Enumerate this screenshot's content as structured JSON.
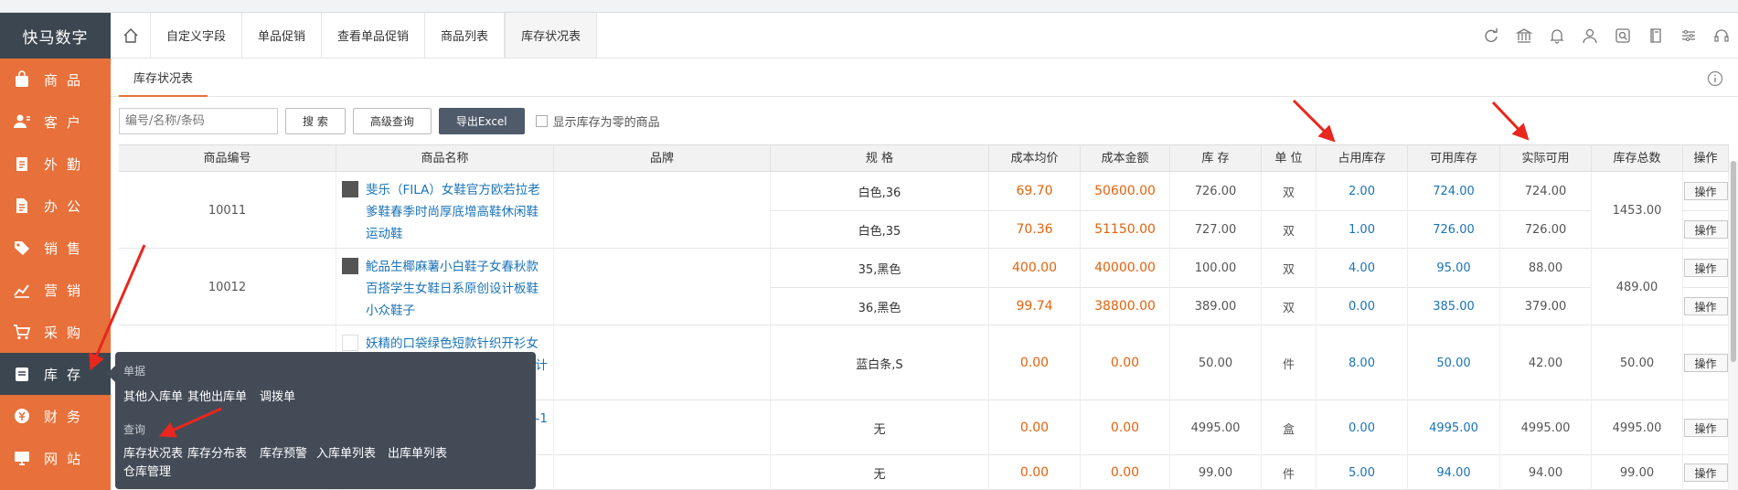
{
  "brand": "快马数字",
  "sidebar": {
    "items": [
      {
        "label": "商品",
        "icon": "bag-icon"
      },
      {
        "label": "客户",
        "icon": "user-icon"
      },
      {
        "label": "外勤",
        "icon": "clipboard-icon"
      },
      {
        "label": "办公",
        "icon": "document-icon"
      },
      {
        "label": "销售",
        "icon": "tag-icon"
      },
      {
        "label": "营销",
        "icon": "chart-icon"
      },
      {
        "label": "采购",
        "icon": "cart-icon"
      },
      {
        "label": "库存",
        "icon": "inventory-icon"
      },
      {
        "label": "财务",
        "icon": "money-icon"
      },
      {
        "label": "网站",
        "icon": "monitor-icon"
      }
    ]
  },
  "tabs": [
    "自定义字段",
    "单品促销",
    "查看单品促销",
    "商品列表",
    "库存状况表"
  ],
  "active_tab": "库存状况表",
  "subtab": "库存状况表",
  "toolbar": {
    "search_placeholder": "编号/名称/条码",
    "search_label": "搜 索",
    "advanced_label": "高级查询",
    "export_label": "导出Excel",
    "zero_label": "显示库存为零的商品"
  },
  "table": {
    "headers": [
      "商品编号",
      "商品名称",
      "品牌",
      "规 格",
      "成本均价",
      "成本金额",
      "库 存",
      "单 位",
      "占用库存",
      "可用库存",
      "实际可用",
      "库存总数",
      "操作"
    ],
    "groups": [
      {
        "code": "10011",
        "name": "斐乐（FILA）女鞋官方欧若拉老爹鞋春季时尚厚底增高鞋休闲鞋运动鞋",
        "total": "1453.00",
        "rows": [
          {
            "spec": "白色,36",
            "cost": "69.70",
            "amount": "50600.00",
            "stock": "726.00",
            "unit": "双",
            "occupied": "2.00",
            "available": "724.00",
            "actual": "724.00",
            "op": "操作"
          },
          {
            "spec": "白色,35",
            "cost": "70.36",
            "amount": "51150.00",
            "stock": "727.00",
            "unit": "双",
            "occupied": "1.00",
            "available": "726.00",
            "actual": "726.00",
            "op": "操作"
          }
        ]
      },
      {
        "code": "10012",
        "name": "鮀品生椰麻薯小白鞋子女春秋款百搭学生女鞋日系原创设计板鞋小众鞋子",
        "total": "489.00",
        "rows": [
          {
            "spec": "35,黑色",
            "cost": "400.00",
            "amount": "40000.00",
            "stock": "100.00",
            "unit": "双",
            "occupied": "4.00",
            "available": "95.00",
            "actual": "88.00",
            "op": "操作"
          },
          {
            "spec": "36,黑色",
            "cost": "99.74",
            "amount": "38800.00",
            "stock": "389.00",
            "unit": "双",
            "occupied": "0.00",
            "available": "385.00",
            "actual": "379.00",
            "op": "操作"
          }
        ]
      },
      {
        "code": "",
        "name": "妖精的口袋绿色短款针织开衫女",
        "name_tail": "计",
        "total": "50.00",
        "rows": [
          {
            "spec": "蓝白条,S",
            "cost": "0.00",
            "amount": "0.00",
            "stock": "50.00",
            "unit": "件",
            "occupied": "8.00",
            "available": "50.00",
            "actual": "42.00",
            "op": "操作"
          }
        ]
      },
      {
        "code": "",
        "name": "",
        "name_tail": "-1",
        "total": "4995.00",
        "rows": [
          {
            "spec": "无",
            "cost": "0.00",
            "amount": "0.00",
            "stock": "4995.00",
            "unit": "盒",
            "occupied": "0.00",
            "available": "4995.00",
            "actual": "4995.00",
            "op": "操作"
          }
        ]
      },
      {
        "code": "",
        "name": "",
        "total": "99.00",
        "rows": [
          {
            "spec": "无",
            "cost": "0.00",
            "amount": "0.00",
            "stock": "99.00",
            "unit": "件",
            "occupied": "5.00",
            "available": "94.00",
            "actual": "94.00",
            "op": "操作"
          }
        ]
      }
    ]
  },
  "popup": {
    "group1_title": "单据",
    "group1_items": [
      "其他入库单",
      "其他出库单",
      "调拨单"
    ],
    "group2_title": "查询",
    "group2_items": [
      "库存状况表",
      "库存分布表",
      "库存预警",
      "入库单列表",
      "出库单列表",
      "仓库管理"
    ]
  },
  "colors": {
    "sidebar": "#e8703a",
    "brand_bg": "#3c4650",
    "popup_bg": "#434b57",
    "orange_value": "#e3620c",
    "blue_value": "#1a73b8",
    "annotation_arrow": "#e8271e"
  }
}
